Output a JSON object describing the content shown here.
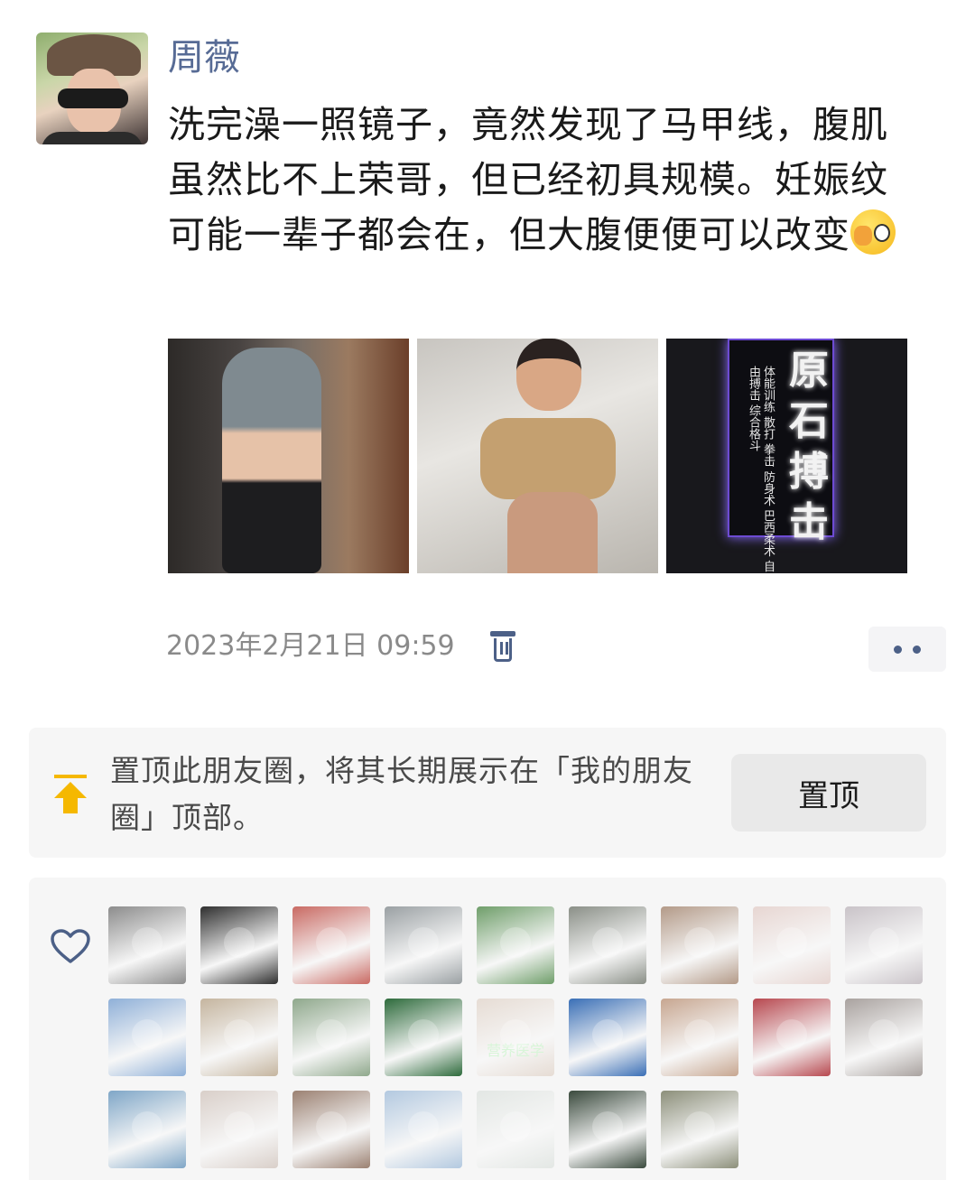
{
  "post": {
    "author": "周薇",
    "text": "洗完澡一照镜子，竟然发现了马甲线，腹肌虽然比不上荣哥，但已经初具规模。妊娠纹可能一辈子都会在，但大腹便便可以改变",
    "emoji_icon": "wink-hand-emoji",
    "photos": [
      {
        "icon": "mirror-selfie-photo"
      },
      {
        "icon": "child-belly-photo"
      },
      {
        "icon": "neon-sign-photo",
        "sign_main": "原石搏击",
        "sign_side": "体能训练 散打 拳击 防身术 巴西柔术 自由搏击 综合格斗"
      }
    ],
    "timestamp": "2023年2月21日 09:59",
    "delete_icon": "trash-icon",
    "more_icon": "more-dots-icon"
  },
  "pin": {
    "text": "置顶此朋友圈，将其长期展示在「我的朋友圈」顶部。",
    "button_label": "置顶",
    "icon": "pin-top-icon"
  },
  "likes": {
    "icon": "heart-icon",
    "count": 25,
    "colors": [
      "#8c8c8c",
      "#2f2f2f",
      "#c96a63",
      "#9aa0a3",
      "#6f9e6a",
      "#8a8f87",
      "#b39a88",
      "#e7d6d2",
      "#c9c3c8",
      "#8fb0d8",
      "#c5b59f",
      "#8fa88c",
      "#2e6b3c",
      "#e6dcd4",
      "#3a6fb6",
      "#c7a690",
      "#b7484f",
      "#a9a29f",
      "#7fa6c7",
      "#d9cfc9",
      "#9b8172",
      "#b3c9e0",
      "#e3e7e4",
      "#3a4a3d",
      "#8c8f7a"
    ],
    "overlay_text": {
      "13": "营养医学"
    }
  }
}
